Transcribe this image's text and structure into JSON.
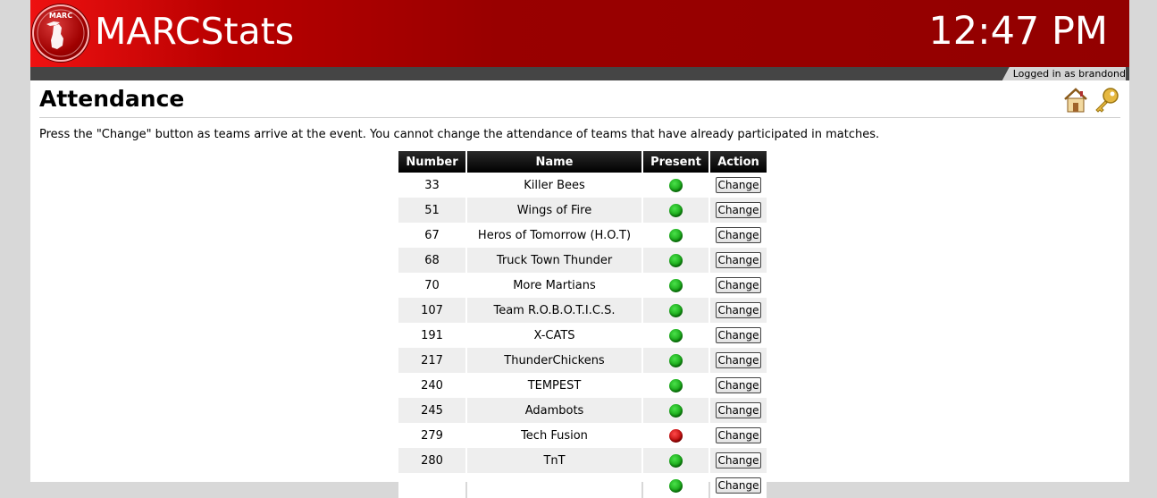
{
  "header": {
    "app_name": "MARCStats",
    "clock": "12:47 PM",
    "logo_text": "MARC",
    "logged_in": "Logged in as brandond"
  },
  "page": {
    "title": "Attendance",
    "instructions": "Press the \"Change\" button as teams arrive at the event. You cannot change the attendance of teams that have already participated in matches."
  },
  "nav_icons": [
    "home-icon",
    "key-icon"
  ],
  "table": {
    "columns": [
      "Number",
      "Name",
      "Present",
      "Action"
    ],
    "rows": [
      {
        "number": "33",
        "name": "Killer Bees",
        "present": "green",
        "action": "Change"
      },
      {
        "number": "51",
        "name": "Wings of Fire",
        "present": "green",
        "action": "Change"
      },
      {
        "number": "67",
        "name": "Heros of Tomorrow (H.O.T)",
        "present": "green",
        "action": "Change"
      },
      {
        "number": "68",
        "name": "Truck Town Thunder",
        "present": "green",
        "action": "Change"
      },
      {
        "number": "70",
        "name": "More Martians",
        "present": "green",
        "action": "Change"
      },
      {
        "number": "107",
        "name": "Team R.O.B.O.T.I.C.S.",
        "present": "green",
        "action": "Change"
      },
      {
        "number": "191",
        "name": "X-CATS",
        "present": "green",
        "action": "Change"
      },
      {
        "number": "217",
        "name": "ThunderChickens",
        "present": "green",
        "action": "Change"
      },
      {
        "number": "240",
        "name": "TEMPEST",
        "present": "green",
        "action": "Change"
      },
      {
        "number": "245",
        "name": "Adambots",
        "present": "green",
        "action": "Change"
      },
      {
        "number": "279",
        "name": "Tech Fusion",
        "present": "red",
        "action": "Change"
      },
      {
        "number": "280",
        "name": "TnT",
        "present": "green",
        "action": "Change"
      },
      {
        "number": "",
        "name": "",
        "present": "green",
        "action": "Change"
      }
    ]
  },
  "colors": {
    "banner_red": "#930000",
    "present_green": "#0d9a0d",
    "absent_red": "#b40000"
  }
}
